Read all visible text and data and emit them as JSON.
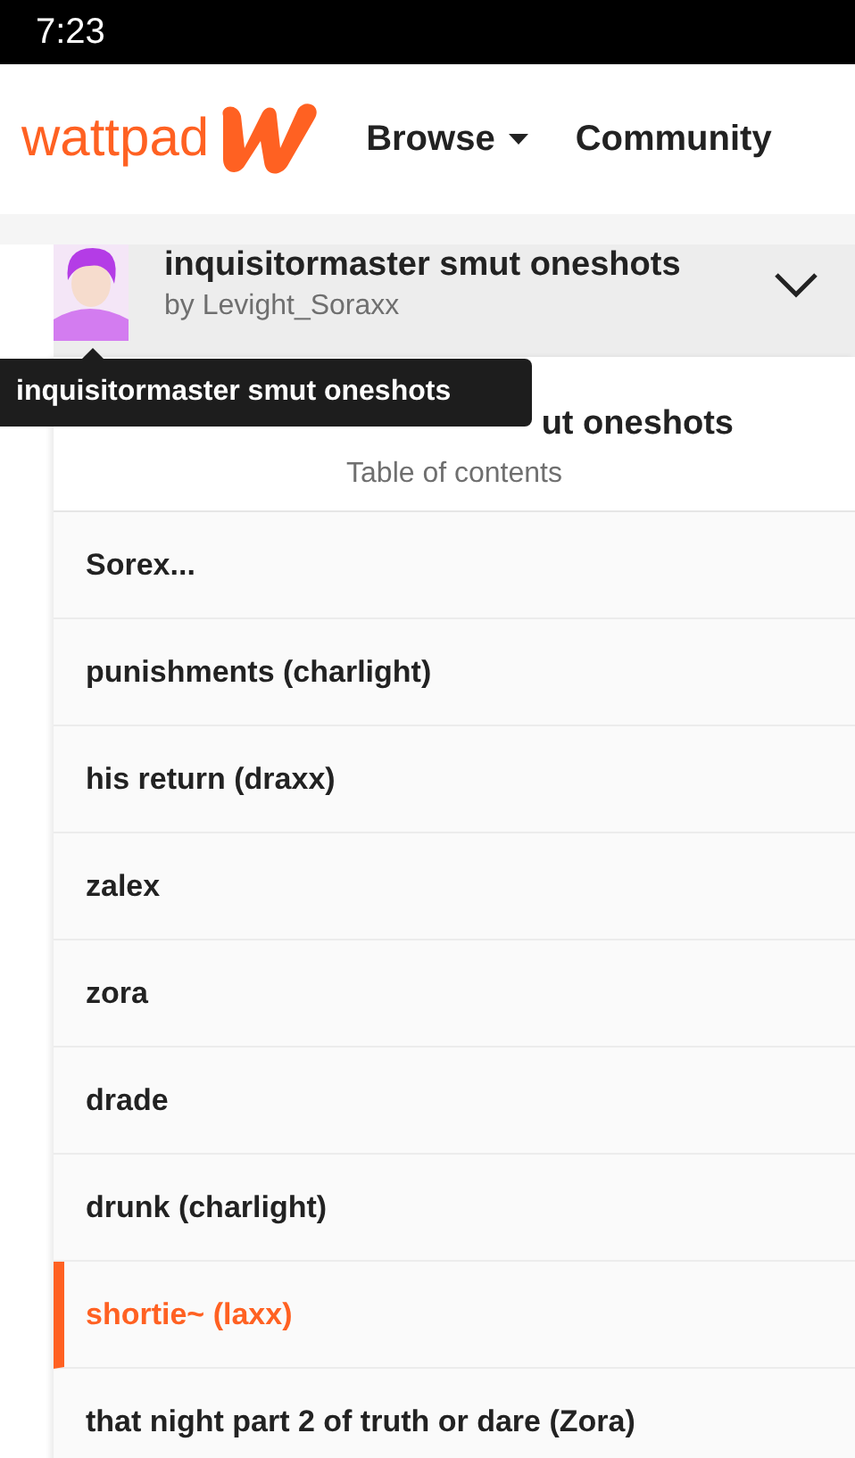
{
  "status_bar": {
    "time": "7:23"
  },
  "nav": {
    "logo": "wattpad",
    "items": [
      {
        "label": "Browse",
        "dropdown": true
      },
      {
        "label": "Community",
        "dropdown": false
      }
    ]
  },
  "story": {
    "title": "inquisitormaster smut oneshots",
    "author": "by Levight_Soraxx",
    "expanded": true
  },
  "tooltip": {
    "text": "inquisitormaster smut oneshots"
  },
  "toc": {
    "title_visible": "ut oneshots",
    "subtitle": "Table of contents",
    "chapters": [
      {
        "title": "Sorex...",
        "selected": false
      },
      {
        "title": "punishments (charlight)",
        "selected": false
      },
      {
        "title": "his return (draxx)",
        "selected": false
      },
      {
        "title": "zalex",
        "selected": false
      },
      {
        "title": "zora",
        "selected": false
      },
      {
        "title": "drade",
        "selected": false
      },
      {
        "title": "drunk (charlight)",
        "selected": false
      },
      {
        "title": "shortie~ (laxx)",
        "selected": true
      },
      {
        "title": "that night part 2 of truth or dare (Zora)",
        "selected": false
      }
    ]
  }
}
